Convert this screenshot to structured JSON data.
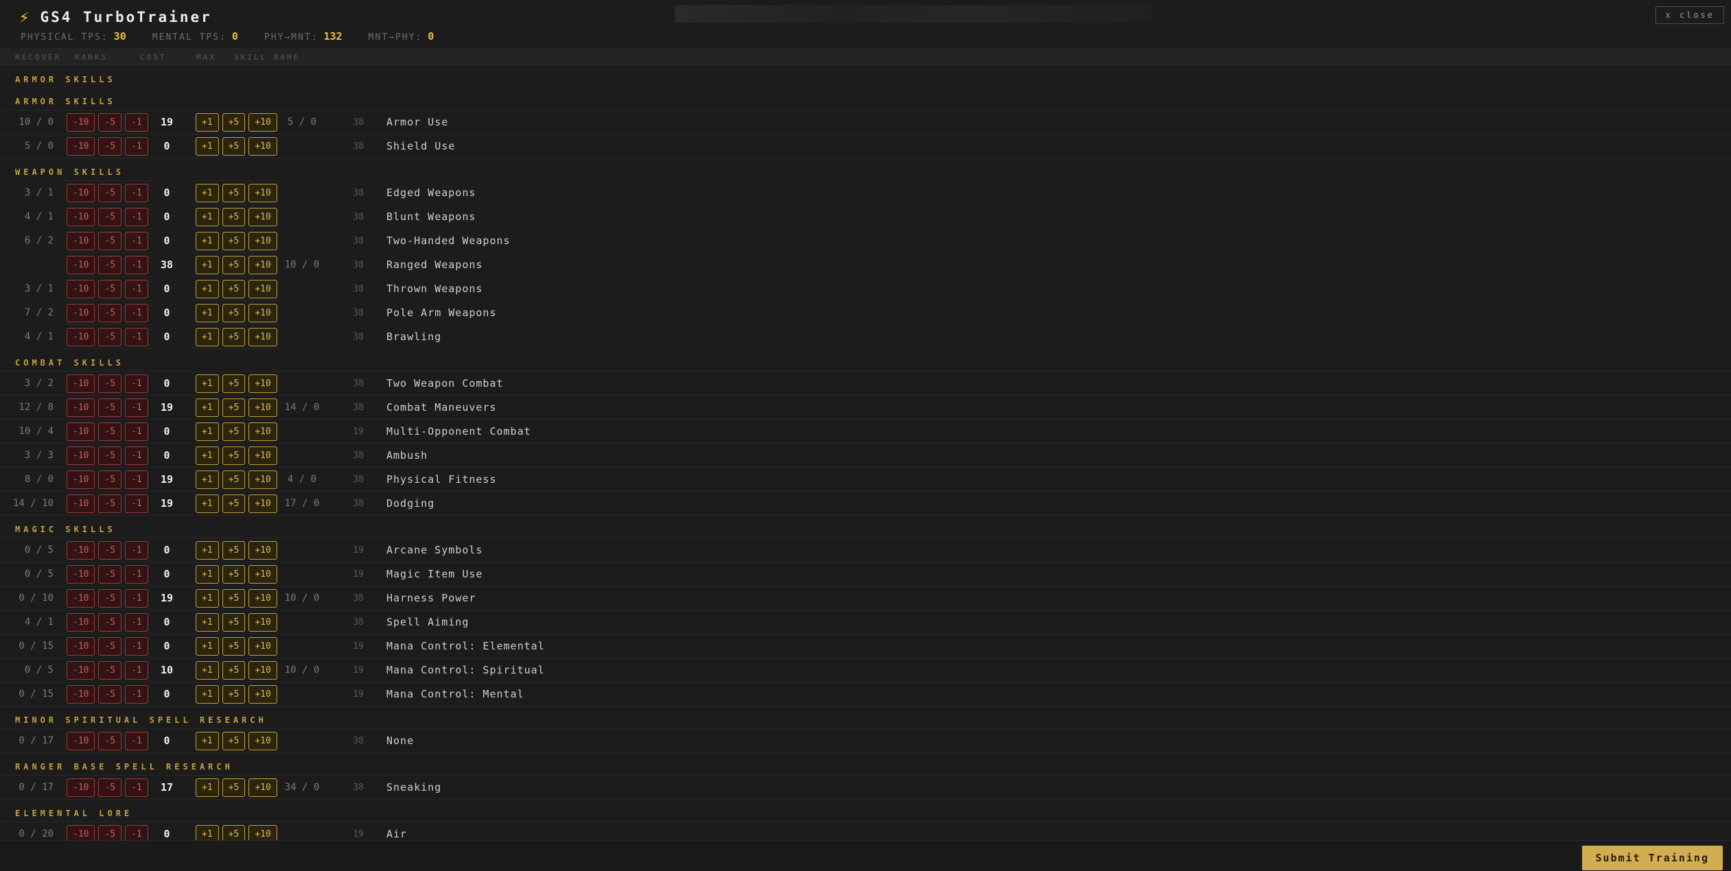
{
  "app": {
    "title": "GS4 TurboTrainer",
    "bolt_icon": "⚡",
    "close_label": "x close"
  },
  "stats": [
    {
      "label": "PHYSICAL TPS:",
      "value": "30"
    },
    {
      "label": "MENTAL TPS:",
      "value": "0"
    },
    {
      "label": "PHY→MNT:",
      "value": "132"
    },
    {
      "label": "MNT→PHY:",
      "value": "0"
    }
  ],
  "columns": [
    "RECOVER",
    "RANKS",
    "COST",
    "MAX",
    "SKILL NAME"
  ],
  "buttons": {
    "minus": [
      "-10",
      "-5",
      "-1"
    ],
    "plus": [
      "+1",
      "+5",
      "+10"
    ]
  },
  "sections": [
    {
      "title": "ARMOR SKILLS",
      "rows": []
    },
    {
      "title": "ARMOR SKILLS",
      "rows": [
        {
          "recover": "10 / 0",
          "cost": "19",
          "max": "5 / 0",
          "base": "38",
          "name": "Armor Use"
        },
        {
          "recover": "5 / 0",
          "cost": "0",
          "max": "",
          "base": "38",
          "name": "Shield Use"
        }
      ]
    },
    {
      "title": "WEAPON SKILLS",
      "rows": [
        {
          "recover": "3 / 1",
          "cost": "0",
          "max": "",
          "base": "38",
          "name": "Edged Weapons"
        },
        {
          "recover": "4 / 1",
          "cost": "0",
          "max": "",
          "base": "38",
          "name": "Blunt Weapons"
        },
        {
          "recover": "6 / 2",
          "cost": "0",
          "max": "",
          "base": "38",
          "name": "Two-Handed Weapons"
        },
        {
          "recover": "",
          "cost": "38",
          "max": "10 / 0",
          "base": "38",
          "name": "Ranged Weapons"
        },
        {
          "recover": "3 / 1",
          "cost": "0",
          "max": "",
          "base": "38",
          "name": "Thrown Weapons"
        },
        {
          "recover": "7 / 2",
          "cost": "0",
          "max": "",
          "base": "38",
          "name": "Pole Arm Weapons"
        },
        {
          "recover": "4 / 1",
          "cost": "0",
          "max": "",
          "base": "38",
          "name": "Brawling"
        }
      ]
    },
    {
      "title": "COMBAT SKILLS",
      "rows": [
        {
          "recover": "3 / 2",
          "cost": "0",
          "max": "",
          "base": "38",
          "name": "Two Weapon Combat"
        },
        {
          "recover": "12 / 8",
          "cost": "19",
          "max": "14 / 0",
          "base": "38",
          "name": "Combat Maneuvers"
        },
        {
          "recover": "10 / 4",
          "cost": "0",
          "max": "",
          "base": "19",
          "name": "Multi-Opponent Combat"
        },
        {
          "recover": "3 / 3",
          "cost": "0",
          "max": "",
          "base": "38",
          "name": "Ambush"
        },
        {
          "recover": "8 / 0",
          "cost": "19",
          "max": "4 / 0",
          "base": "38",
          "name": "Physical Fitness"
        },
        {
          "recover": "14 / 10",
          "cost": "19",
          "max": "17 / 0",
          "base": "38",
          "name": "Dodging"
        }
      ]
    },
    {
      "title": "MAGIC SKILLS",
      "rows": [
        {
          "recover": "0 / 5",
          "cost": "0",
          "max": "",
          "base": "19",
          "name": "Arcane Symbols"
        },
        {
          "recover": "0 / 5",
          "cost": "0",
          "max": "",
          "base": "19",
          "name": "Magic Item Use"
        },
        {
          "recover": "0 / 10",
          "cost": "19",
          "max": "10 / 0",
          "base": "38",
          "name": "Harness Power"
        },
        {
          "recover": "4 / 1",
          "cost": "0",
          "max": "",
          "base": "38",
          "name": "Spell Aiming"
        },
        {
          "recover": "0 / 15",
          "cost": "0",
          "max": "",
          "base": "19",
          "name": "Mana Control: Elemental"
        },
        {
          "recover": "0 / 5",
          "cost": "10",
          "max": "10 / 0",
          "base": "19",
          "name": "Mana Control: Spiritual"
        },
        {
          "recover": "0 / 15",
          "cost": "0",
          "max": "",
          "base": "19",
          "name": "Mana Control: Mental"
        }
      ]
    },
    {
      "title": "MINOR SPIRITUAL SPELL RESEARCH",
      "rows": [
        {
          "recover": "0 / 17",
          "cost": "0",
          "max": "",
          "base": "38",
          "name": "None"
        }
      ]
    },
    {
      "title": "RANGER BASE SPELL RESEARCH",
      "rows": [
        {
          "recover": "0 / 17",
          "cost": "17",
          "max": "34 / 0",
          "base": "38",
          "name": "Sneaking"
        }
      ]
    },
    {
      "title": "ELEMENTAL LORE",
      "rows": [
        {
          "recover": "0 / 20",
          "cost": "0",
          "max": "",
          "base": "19",
          "name": "Air"
        }
      ]
    }
  ],
  "footer": {
    "submit_label": "Submit Training"
  },
  "colors": {
    "background": "#1c1c1d",
    "accent_gold": "#d2ad52",
    "section_gold": "#c5a03c",
    "value_gold": "#e5c23f",
    "accent_red": "#cd5c5c",
    "cost_white": "#f2f2f2"
  }
}
